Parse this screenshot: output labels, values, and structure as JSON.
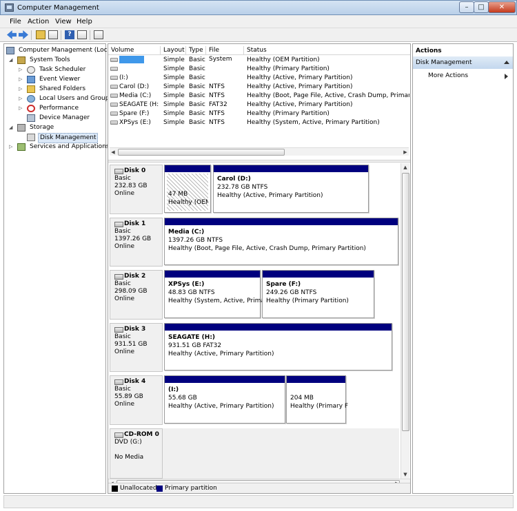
{
  "window": {
    "title": "Computer Management",
    "controls": {
      "minimize": "–",
      "maximize": "□",
      "close": "✕"
    }
  },
  "menu": [
    "File",
    "Action",
    "View",
    "Help"
  ],
  "toolbar": {
    "icons": [
      "back-arrow-icon",
      "forward-arrow-icon",
      "up-folder-icon",
      "show-hide-tree-icon",
      "help-icon",
      "properties-icon",
      "export-icon"
    ],
    "help_glyph": "?"
  },
  "tree": {
    "root": "Computer Management (Local",
    "system_tools": "System Tools",
    "task_scheduler": "Task Scheduler",
    "event_viewer": "Event Viewer",
    "shared_folders": "Shared Folders",
    "local_users": "Local Users and Groups",
    "performance": "Performance",
    "device_manager": "Device Manager",
    "storage": "Storage",
    "disk_management": "Disk Management",
    "services": "Services and Applications"
  },
  "volumes": {
    "columns": [
      "Volume",
      "Layout",
      "Type",
      "File System",
      "Status"
    ],
    "rows": [
      {
        "volume": "",
        "layout": "Simple",
        "type": "Basic",
        "fs": "",
        "status": "Healthy (OEM Partition)"
      },
      {
        "volume": "",
        "layout": "Simple",
        "type": "Basic",
        "fs": "",
        "status": "Healthy (Primary Partition)"
      },
      {
        "volume": "(I:)",
        "layout": "Simple",
        "type": "Basic",
        "fs": "",
        "status": "Healthy (Active, Primary Partition)"
      },
      {
        "volume": "Carol (D:)",
        "layout": "Simple",
        "type": "Basic",
        "fs": "NTFS",
        "status": "Healthy (Active, Primary Partition)"
      },
      {
        "volume": "Media (C:)",
        "layout": "Simple",
        "type": "Basic",
        "fs": "NTFS",
        "status": "Healthy (Boot, Page File, Active, Crash Dump, Primary Par"
      },
      {
        "volume": "SEAGATE (H:)",
        "layout": "Simple",
        "type": "Basic",
        "fs": "FAT32",
        "status": "Healthy (Active, Primary Partition)"
      },
      {
        "volume": "Spare (F:)",
        "layout": "Simple",
        "type": "Basic",
        "fs": "NTFS",
        "status": "Healthy (Primary Partition)"
      },
      {
        "volume": "XPSys (E:)",
        "layout": "Simple",
        "type": "Basic",
        "fs": "NTFS",
        "status": "Healthy (System, Active, Primary Partition)"
      }
    ]
  },
  "disks": [
    {
      "name": "Disk 0",
      "type": "Basic",
      "size": "232.83 GB",
      "state": "Online",
      "partitions": [
        {
          "name": "",
          "size": "47 MB",
          "status": "Healthy (OEM",
          "hatched": true
        },
        {
          "name": "Carol  (D:)",
          "size": "232.78 GB NTFS",
          "status": "Healthy (Active, Primary Partition)"
        }
      ]
    },
    {
      "name": "Disk 1",
      "type": "Basic",
      "size": "1397.26 GB",
      "state": "Online",
      "partitions": [
        {
          "name": "Media  (C:)",
          "size": "1397.26 GB NTFS",
          "status": "Healthy (Boot, Page File, Active, Crash Dump, Primary Partition)"
        }
      ]
    },
    {
      "name": "Disk 2",
      "type": "Basic",
      "size": "298.09 GB",
      "state": "Online",
      "partitions": [
        {
          "name": "XPSys  (E:)",
          "size": "48.83 GB NTFS",
          "status": "Healthy (System, Active, Primar"
        },
        {
          "name": "Spare  (F:)",
          "size": "249.26 GB NTFS",
          "status": "Healthy (Primary Partition)"
        }
      ]
    },
    {
      "name": "Disk 3",
      "type": "Basic",
      "size": "931.51 GB",
      "state": "Online",
      "partitions": [
        {
          "name": "SEAGATE  (H:)",
          "size": "931.51 GB FAT32",
          "status": "Healthy (Active, Primary Partition)"
        }
      ]
    },
    {
      "name": "Disk 4",
      "type": "Basic",
      "size": "55.89 GB",
      "state": "Online",
      "partitions": [
        {
          "name": "(I:)",
          "size": "55.68 GB",
          "status": "Healthy (Active, Primary Partition)"
        },
        {
          "name": "",
          "size": "204 MB",
          "status": "Healthy (Primary F"
        }
      ]
    },
    {
      "name": "CD-ROM 0",
      "type": "DVD (G:)",
      "size": "",
      "state": "No Media",
      "partitions": []
    }
  ],
  "legend": {
    "unallocated": "Unallocated",
    "primary": "Primary partition",
    "unallocated_color": "#000000",
    "primary_color": "#00007e"
  },
  "actions": {
    "header": "Actions",
    "section": "Disk Management",
    "more": "More Actions"
  },
  "colors": {
    "partition_bar": "#00007e",
    "selection": "#3f98ea"
  }
}
